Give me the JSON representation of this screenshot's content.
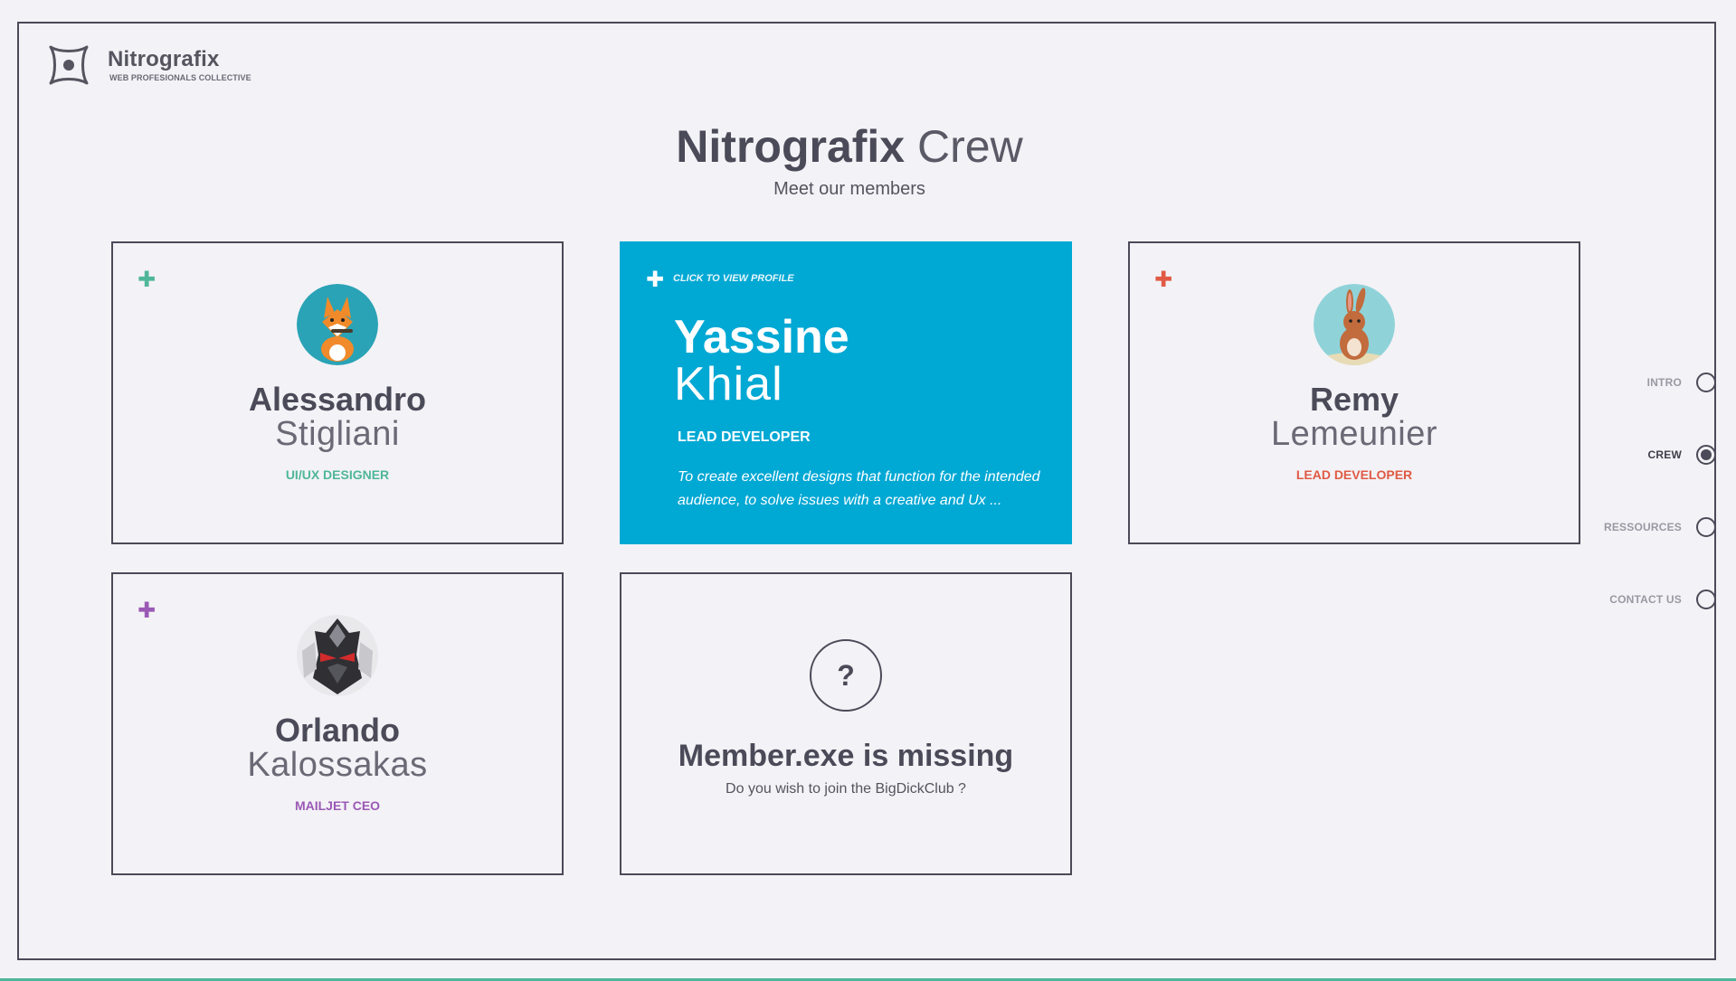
{
  "brand": {
    "name": "Nitrografix",
    "tagline": "WEB PROFESIONALS COLLECTIVE",
    "icon": "logo-mark-icon"
  },
  "heading": {
    "title_strong": "Nitrografix",
    "title_light": "Crew",
    "subtitle": "Meet our members"
  },
  "members": [
    {
      "first": "Alessandro",
      "last": "Stigliani",
      "role": "UI/UX DESIGNER",
      "accent": "#4fb69a",
      "avatar_icon": "fox-avatar-icon"
    },
    {
      "first": "Yassine",
      "last": "Khial",
      "role": "LEAD DEVELOPER",
      "hint": "CLICK TO VIEW PROFILE",
      "description": "To create excellent designs that function for the intended audience, to solve issues with a creative and Ux ...",
      "accent": "#00a8d4"
    },
    {
      "first": "Remy",
      "last": "Lemeunier",
      "role": "LEAD DEVELOPER",
      "accent": "#e05a45",
      "avatar_icon": "rabbit-avatar-icon"
    },
    {
      "first": "Orlando",
      "last": "Kalossakas",
      "role": "MAILJET CEO",
      "accent": "#9b59b6",
      "avatar_icon": "armored-warrior-avatar-icon"
    }
  ],
  "missing": {
    "symbol": "?",
    "title": "Member.exe is missing",
    "subtitle": "Do you wish to join the BigDickClub ?"
  },
  "nav": {
    "items": [
      {
        "label": "INTRO",
        "active": false
      },
      {
        "label": "CREW",
        "active": true
      },
      {
        "label": "RESSOURCES",
        "active": false
      },
      {
        "label": "CONTACT US",
        "active": false
      }
    ]
  }
}
